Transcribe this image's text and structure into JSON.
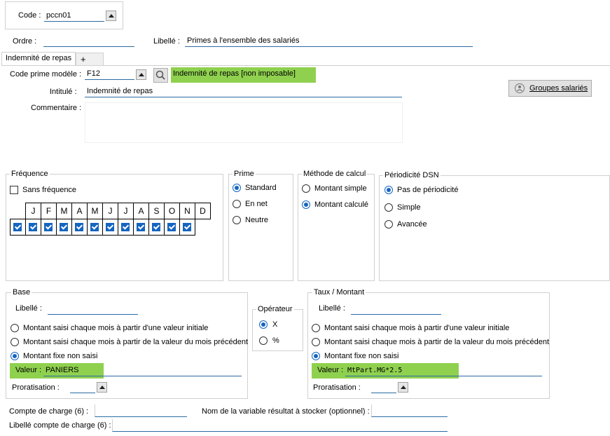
{
  "header": {
    "code_label": "Code :",
    "code_value": "pccn01",
    "ordre_label": "Ordre :",
    "ordre_value": "",
    "libelle_label": "Libellé :",
    "libelle_value": "Primes à l'ensemble des salariés"
  },
  "tabs": [
    {
      "label": "Indemnité de repas"
    },
    {
      "label": "+"
    }
  ],
  "form": {
    "code_prime_label": "Code prime modèle :",
    "code_prime_value": "F12",
    "code_prime_desc": "Indemnité de repas [non imposable]",
    "intitule_label": "Intitulé :",
    "intitule_value": "Indemnité de repas",
    "commentaire_label": "Commentaire :",
    "commentaire_value": "",
    "groupes_button": "Groupes salariés"
  },
  "frequence": {
    "title": "Fréquence",
    "sans_frequence": "Sans fréquence",
    "months": [
      "J",
      "F",
      "M",
      "A",
      "M",
      "J",
      "J",
      "A",
      "S",
      "O",
      "N",
      "D"
    ]
  },
  "prime": {
    "title": "Prime",
    "options": [
      "Standard",
      "En net",
      "Neutre"
    ],
    "selected": "Standard"
  },
  "methode": {
    "title": "Méthode de calcul",
    "options": [
      "Montant simple",
      "Montant calculé"
    ],
    "selected": "Montant calculé"
  },
  "periodicite": {
    "title": "Périodicité DSN",
    "options": [
      "Pas de périodicité",
      "Simple",
      "Avancée"
    ],
    "selected": "Pas de périodicité"
  },
  "base": {
    "title": "Base",
    "libelle_label": "Libellé :",
    "libelle_value": "",
    "options": [
      "Montant saisi chaque mois à partir d'une valeur initiale",
      "Montant saisi chaque mois à partir de la valeur du mois précédent",
      "Montant fixe non saisi"
    ],
    "selected": "Montant fixe non saisi",
    "valeur_label": "Valeur :",
    "valeur_value": "PANIERS",
    "proratisation_label": "Proratisation :"
  },
  "operateur": {
    "title": "Opérateur",
    "options": [
      "X",
      "%"
    ],
    "selected": "X"
  },
  "taux": {
    "title": "Taux / Montant",
    "libelle_label": "Libellé :",
    "libelle_value": "",
    "options": [
      "Montant saisi chaque mois à partir d'une valeur initiale",
      "Montant saisi chaque mois à partir de la valeur du mois précédent",
      "Montant fixe non saisi"
    ],
    "selected": "Montant fixe non saisi",
    "valeur_label": "Valeur :",
    "valeur_value": "MtPart.MG*2.5",
    "proratisation_label": "Proratisation :"
  },
  "footer": {
    "compte_label": "Compte de charge (6) :",
    "compte_value": "",
    "variable_label": "Nom de la variable résultat à stocker (optionnel) :",
    "variable_value": "",
    "libelle_compte_label": "Libellé compte de charge (6) :",
    "libelle_compte_value": ""
  },
  "colors": {
    "highlight": "#8fd14f",
    "accent": "#1565c0"
  }
}
